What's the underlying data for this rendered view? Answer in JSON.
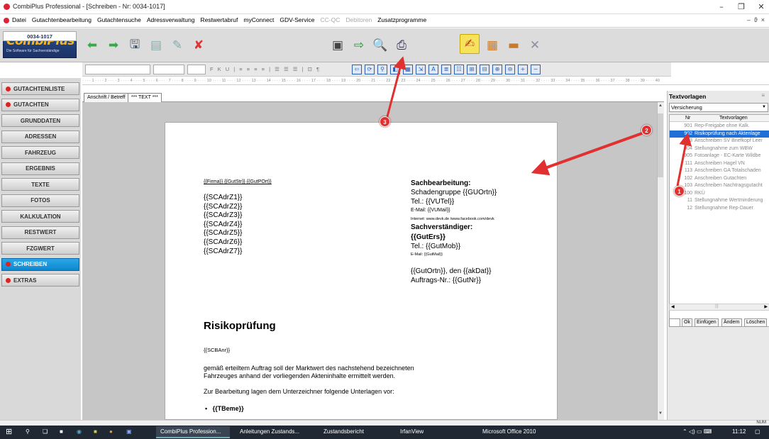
{
  "window": {
    "title": "CombiPlus Professional - [Schreiben - Nr: 0034-1017]"
  },
  "menu": [
    "Datei",
    "Gutachtenbearbeitung",
    "Gutachtensuche",
    "Adressverwaltung",
    "Restwertabruf",
    "myConnect",
    "GDV-Service",
    "CC-QC",
    "Debitoren",
    "Zusatzprogramme"
  ],
  "menu_disabled": [
    "CC-QC",
    "Debitoren"
  ],
  "logo": {
    "name": "CombiPlus",
    "slogan": "Die Software für Sachverständige"
  },
  "doc_number": "0034-1017",
  "nav": [
    {
      "label": "GUTACHTENLISTE",
      "style": "red"
    },
    {
      "label": "GUTACHTEN",
      "style": "red"
    },
    {
      "label": "GRUNDDATEN",
      "style": "plain"
    },
    {
      "label": "ADRESSEN",
      "style": "plain"
    },
    {
      "label": "FAHRZEUG",
      "style": "plain"
    },
    {
      "label": "ERGEBNIS",
      "style": "plain"
    },
    {
      "label": "TEXTE",
      "style": "plain"
    },
    {
      "label": "FOTOS",
      "style": "plain"
    },
    {
      "label": "KALKULATION",
      "style": "plain"
    },
    {
      "label": "RESTWERT",
      "style": "plain"
    },
    {
      "label": "FZGWERT",
      "style": "plain"
    },
    {
      "label": "SCHREIBEN",
      "style": "active"
    },
    {
      "label": "EXTRAS",
      "style": "red"
    }
  ],
  "tabs": [
    "Anschrift / Betreff",
    "*** TEXT ***"
  ],
  "document": {
    "address_line": "{{Firma}} {{GutStr}} {{GutPOrt}}",
    "recipients": [
      "{{SCAdrZ1}}",
      "{{SCAdrZ2}}",
      "{{SCAdrZ3}}",
      "{{SCAdrZ4}}",
      "{{SCAdrZ5}}",
      "{{SCAdrZ6}}",
      "{{SCAdrZ7}}"
    ],
    "sach_head": "Sachbearbeitung:",
    "sach_group": "Schadengruppe {{GUOrtn}}",
    "sach_tel": "Tel.: {{VUTel}}",
    "sach_email": "E-Mail: {{VUMail}}",
    "sach_internet": "Internet: www.devk.de /www.facebook.com/devk",
    "sv_head": "Sachverständiger:",
    "sv_name": "{{GutErs}}",
    "sv_tel": "Tel.: {{GutMob}}",
    "sv_email": "E-Mail: {{GutMail}}",
    "date_line": "{{GutOrtn}}, den {{akDat}}",
    "order_line": "Auftrags-Nr.: {{GutNr}}",
    "heading": "Risikoprüfung",
    "salutation": "{{SCBAnr}}",
    "body1": "gemäß erteiltem Auftrag soll der Marktwert des nachstehend bezeichneten",
    "body2": "Fahrzeuges anhand der vorliegenden Akteninhalte ermittelt werden.",
    "body3": "Zur Bearbeitung lagen dem Unterzeichner folgende Unterlagen vor:",
    "bullet": "{{TBeme}}"
  },
  "textvorlagen": {
    "title": "Textvorlagen",
    "category": "Versicherung",
    "col_nr": "Nr",
    "col_text": "Textvorlagen",
    "rows": [
      {
        "nr": "901",
        "text": "Rep-Freigabe ohne Kalk."
      },
      {
        "nr": "902",
        "text": "Risikoprüfung nach Aktenlage"
      },
      {
        "nr": "903",
        "text": "Anschreiben SV Briefkopf Leer"
      },
      {
        "nr": "904",
        "text": "Stellungnahme zum WBW"
      },
      {
        "nr": "905",
        "text": "Fotoanlage - EC-Karte Wildbe"
      },
      {
        "nr": "111",
        "text": "Anschreiben Hagel VN"
      },
      {
        "nr": "113",
        "text": "Anschreiben GA Totalschaden"
      },
      {
        "nr": "102",
        "text": "Anschreiben Gutachten"
      },
      {
        "nr": "103",
        "text": "Anschreiben Nachtragsgutacht"
      },
      {
        "nr": "100",
        "text": "RKÜ"
      },
      {
        "nr": "11",
        "text": "Stellungnahme Wertminderung"
      },
      {
        "nr": "12",
        "text": "Stellungnahme Rep-Dauer"
      }
    ],
    "selected_nr": "902",
    "buttons": [
      "Ok",
      "Einfügen",
      "Ändern",
      "Löschen"
    ]
  },
  "annotations": [
    "1",
    "2",
    "3"
  ],
  "status": {
    "num": "NUM"
  },
  "taskbar": {
    "items": [
      "CombiPlus Profession...",
      "Anleitungen Zustands...",
      "Zustandsbericht",
      "IrfanView",
      "Microsoft Office 2010"
    ],
    "time": "11:12"
  },
  "colors": {
    "accent_blue": "#1f6fd6",
    "annotation_red": "#e03030",
    "logo_blue": "#2a4b8d",
    "logo_yellow": "#f3b526"
  }
}
